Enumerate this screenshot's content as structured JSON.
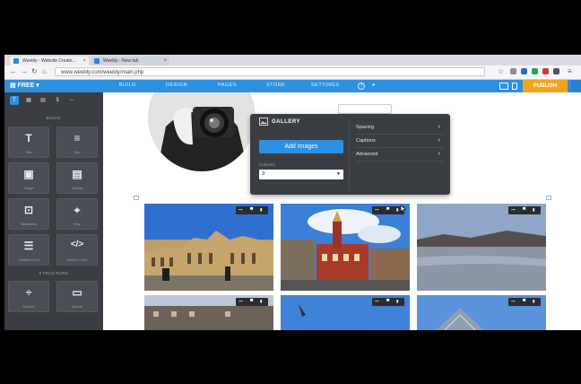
{
  "browser": {
    "tabs": [
      {
        "label": "Weebly - Website Creato..."
      },
      {
        "label": "Weebly - New tab"
      }
    ],
    "url": "www.weebly.com/weebly/main.php"
  },
  "editor": {
    "logo_label": "FREE",
    "menu": [
      "BUILD",
      "DESIGN",
      "PAGES",
      "STORE",
      "SETTINGS"
    ],
    "help_label": "?",
    "publish_label": "PUBLISH"
  },
  "sidebar": {
    "tab_icons": [
      "T",
      "▦",
      "▤",
      "$",
      "⋯"
    ],
    "section_basic": "BASIC",
    "section_structure": "STRUCTURE",
    "tiles": [
      {
        "icon": "T",
        "label": "Title",
        "name": "title-element-tile"
      },
      {
        "icon": "≡",
        "label": "Text",
        "name": "text-element-tile"
      },
      {
        "icon": "▣",
        "label": "Image",
        "name": "image-element-tile"
      },
      {
        "icon": "▤",
        "label": "Gallery",
        "name": "gallery-element-tile"
      },
      {
        "icon": "⊡",
        "label": "Slideshow",
        "name": "slideshow-element-tile"
      },
      {
        "icon": "⌖",
        "label": "Map",
        "name": "map-element-tile"
      },
      {
        "icon": "☰",
        "label": "Contact Form",
        "name": "contact-form-element-tile"
      },
      {
        "icon": "</>",
        "label": "Embed Code",
        "name": "embed-code-element-tile"
      },
      {
        "icon": "÷",
        "label": "Divider",
        "name": "divider-element-tile"
      },
      {
        "icon": "▭",
        "label": "Spacer",
        "name": "spacer-element-tile"
      }
    ]
  },
  "gallery_panel": {
    "title": "GALLERY",
    "add_images_label": "Add Images",
    "columns_label": "Columns",
    "columns_value": "3",
    "options": [
      "Spacing",
      "Captions",
      "Advanced"
    ]
  },
  "colors": {
    "accent_blue": "#2e90e0",
    "publish_orange": "#f2a41c",
    "sidebar_dark": "#3a3d42"
  }
}
